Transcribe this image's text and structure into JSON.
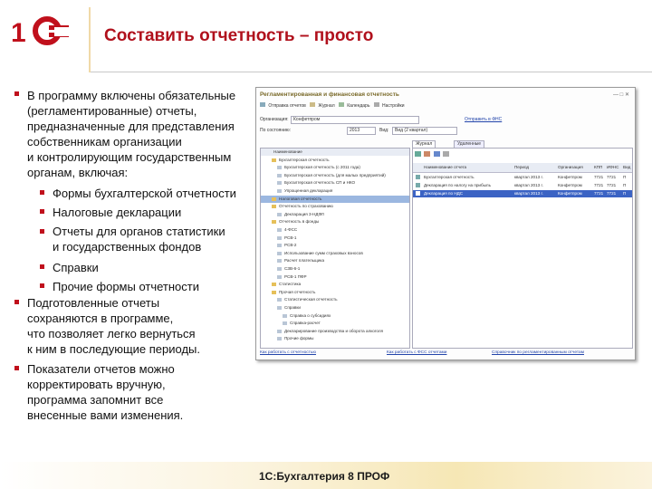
{
  "header": {
    "title": "Составить отчетность – просто",
    "logo_text": "1С"
  },
  "bullets": {
    "b1": [
      "В программу включены обязательные",
      "(регламентированные) отчеты,",
      "предназначенные для представления",
      "собственникам организации",
      "и контролирующим государственным",
      "органам, включая:"
    ],
    "sub": {
      "s1": "Формы бухгалтерской отчетности",
      "s2": "Налоговые декларации",
      "s3": [
        "Отчеты для органов статистики",
        "и государственных фондов"
      ],
      "s4": "Справки",
      "s5": "Прочие формы отчетности"
    },
    "b2": [
      "Подготовленные отчеты",
      "сохраняются в программе,",
      "что позволяет легко вернуться",
      "к ним в последующие периоды."
    ],
    "b3": [
      "Показатели отчетов можно",
      "корректировать вручную,",
      "программа запомнит все",
      "внесенные вами изменения."
    ]
  },
  "footer": "1С:Бухгалтерия 8 ПРОФ",
  "colors": {
    "accent": "#b0101c",
    "bullet": "#c0101c"
  },
  "screenshot": {
    "title": "Регламентированная и финансовая отчетность",
    "toolbar": [
      "Отправка отчетов",
      "Журнал",
      "Календарь",
      "Настройки"
    ],
    "org_label": "Организация:",
    "org_value": "Конфетпром",
    "period_label": "По состоянию:",
    "period_value": "2013",
    "show_label": "Вид:",
    "show_value": "Вид (2 квартал)",
    "tabs": [
      "Журнал отчетов",
      "Удаленные отчеты"
    ],
    "left_tree": [
      "Наименование",
      "Бухгалтерская отчетность",
      "Бухгалтерская отчетность (с 2011 года)",
      "Бухгалтерская отчетность (для малых предприятий)",
      "Бухгалтерская отчетность СП и НКО",
      "Упрощенная декларация",
      "Налоговая отчетность",
      "Отчетность по страхованию",
      "Декларация 3-НДФЛ",
      "Отчетность в фонды",
      "4-ФСС",
      "РСВ-1",
      "РСВ-2",
      "Использование сумм страховых взносов",
      "Расчет плательщика",
      "СЗВ-6-1",
      "РСВ-1 ПФР",
      "Статистика",
      "Прочая отчетность",
      "Статистическая отчетность",
      "Справки",
      "Справка о субсидиях",
      "Справка-расчет",
      "Декларирование производства и оборота алкоголя",
      "Прочие формы"
    ],
    "grid_headers": [
      "Наименование отчета",
      "Период",
      "Организация",
      "КПП",
      "ИФНС",
      "Вид"
    ],
    "grid_rows": [
      [
        "Бухгалтерская отчетность",
        "квартал 2013 г.",
        "Конфетпром",
        "7721",
        "7721",
        "П"
      ],
      [
        "Декларация по налогу на прибыль",
        "квартал 2013 г.",
        "Конфетпром",
        "7721",
        "7721",
        "П"
      ],
      [
        "Декларация по НДС",
        "квартал 2013 г.",
        "Конфетпром",
        "7721",
        "7721",
        "П"
      ]
    ],
    "right_link": "Отправить в ФНС",
    "bottom_links": [
      "Как работать с отчетностью",
      "Как работать с ФСС отчетами",
      "Справочник по регламентированным отчетам"
    ]
  }
}
